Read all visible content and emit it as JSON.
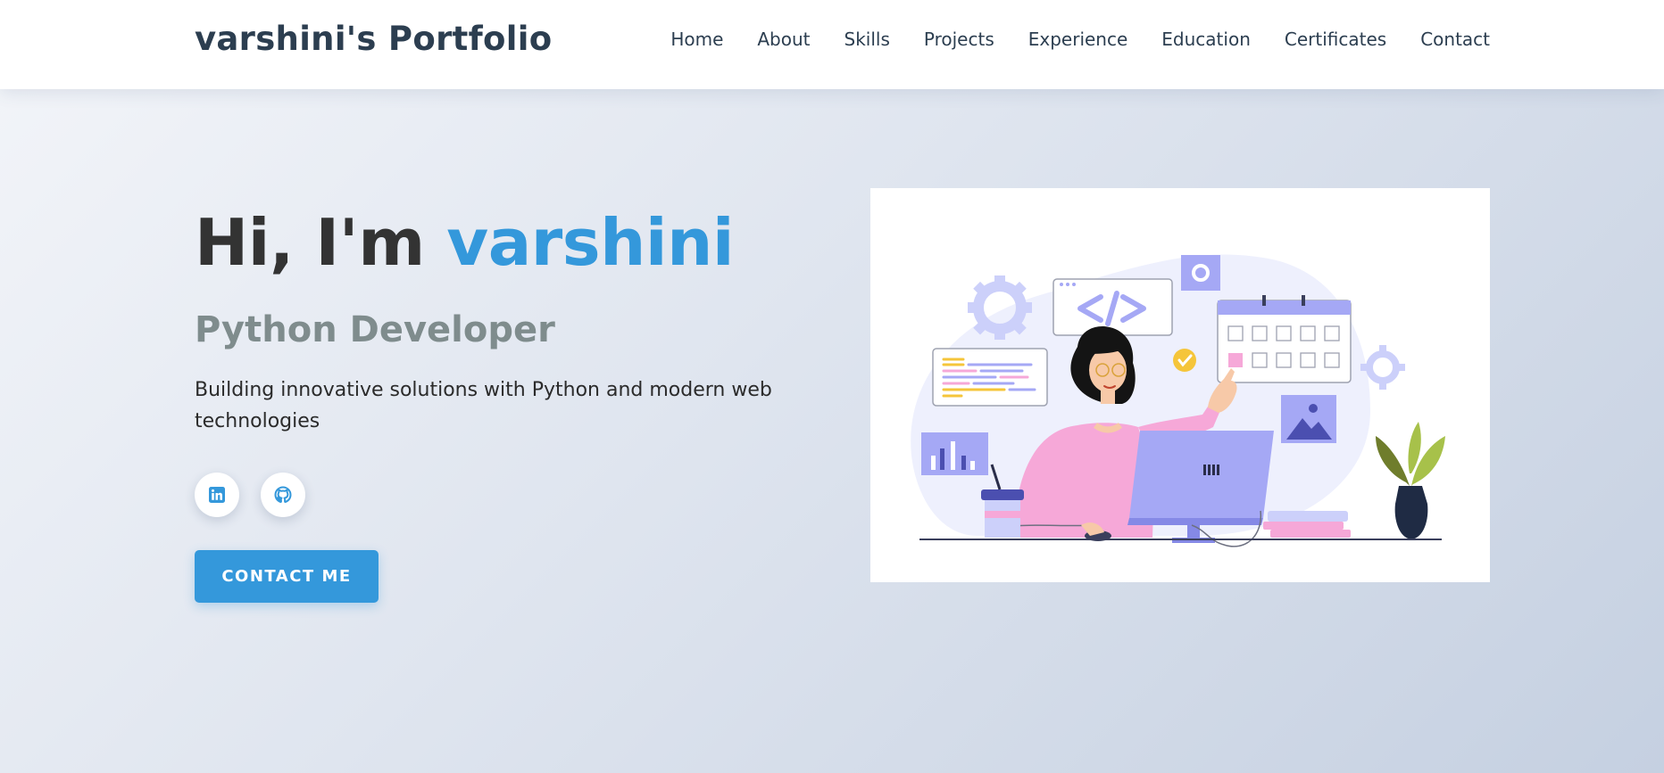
{
  "nav": {
    "logo": "varshini's Portfolio",
    "links": [
      "Home",
      "About",
      "Skills",
      "Projects",
      "Experience",
      "Education",
      "Certificates",
      "Contact"
    ]
  },
  "hero": {
    "greeting_prefix": "Hi, I'm ",
    "greeting_name": "varshini",
    "role": "Python Developer",
    "tagline": "Building innovative solutions with Python and modern web technologies",
    "cta_label": "CONTACT ME"
  },
  "socials": [
    {
      "name": "linkedin",
      "icon": "linkedin-icon"
    },
    {
      "name": "github",
      "icon": "github-icon"
    }
  ],
  "illustration": {
    "subject": "developer-at-desk-illustration"
  },
  "colors": {
    "accent": "#3498db",
    "nav_text": "#2c3e50",
    "role_text": "#7f8c8d",
    "greeting_text": "#333333",
    "illustration_purple": "#a5a8f5",
    "illustration_pink": "#f6a8d8"
  }
}
